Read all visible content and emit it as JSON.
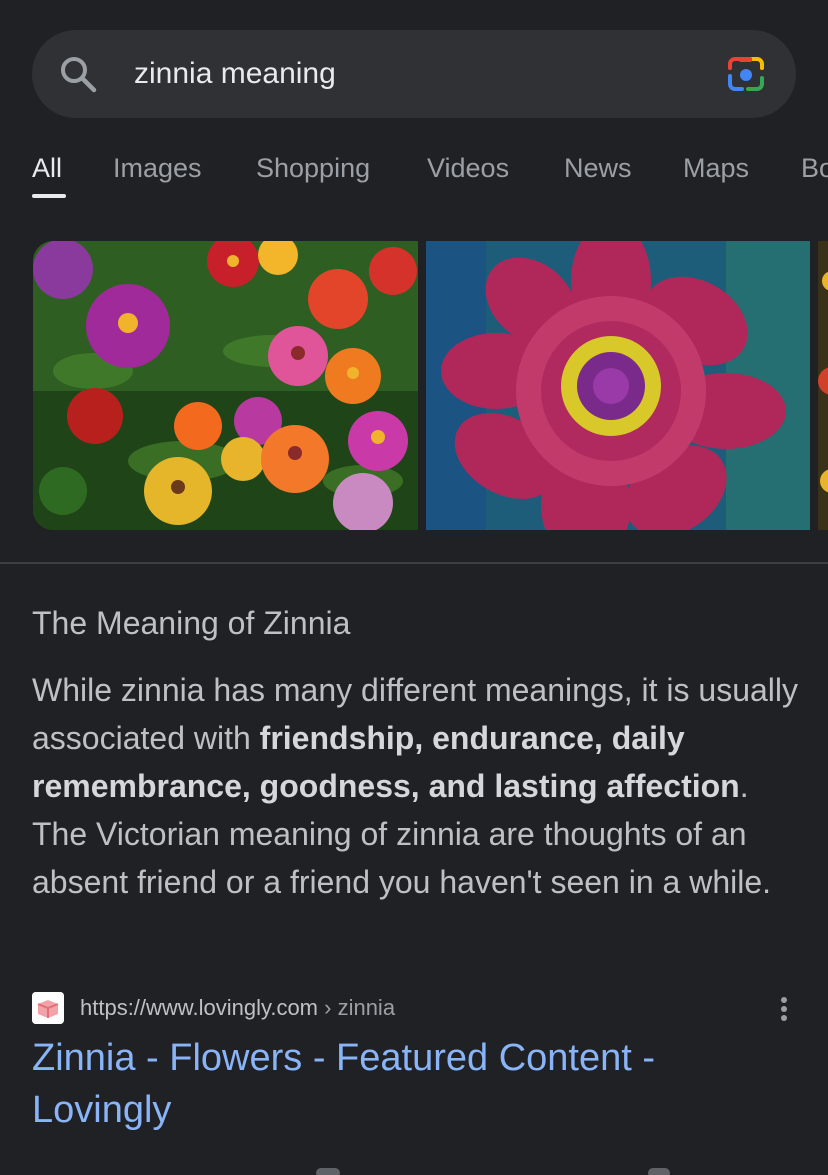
{
  "search": {
    "query": "zinnia meaning"
  },
  "tabs": [
    {
      "label": "All",
      "active": true
    },
    {
      "label": "Images"
    },
    {
      "label": "Shopping"
    },
    {
      "label": "Videos"
    },
    {
      "label": "News"
    },
    {
      "label": "Maps"
    },
    {
      "label": "Bo"
    }
  ],
  "images": [
    {
      "subject": "field of multicolored zinnias"
    },
    {
      "subject": "single magenta zinnia close-up"
    },
    {
      "subject": "zinnia (partially visible)"
    }
  ],
  "snippet": {
    "title": "The Meaning of Zinnia",
    "text_1": "While zinnia has many different meanings, it is usually associated with ",
    "bold": "friendship, endurance, daily remembrance, goodness, and lasting affection",
    "text_2": ". The Victorian meaning of zinnia are thoughts of an absent friend or a friend you haven't seen in a while."
  },
  "result": {
    "url": "https://www.lovingly.com",
    "path": " › zinnia",
    "title": "Zinnia - Flowers - Featured Content - Lovingly"
  },
  "icons": {
    "search": "search-icon",
    "lens": "google-lens-icon",
    "more": "more-vert-icon",
    "favicon": "lovingly-favicon"
  },
  "colors": {
    "background": "#202124",
    "link": "#8ab4f8",
    "search_bar": "#303134"
  }
}
